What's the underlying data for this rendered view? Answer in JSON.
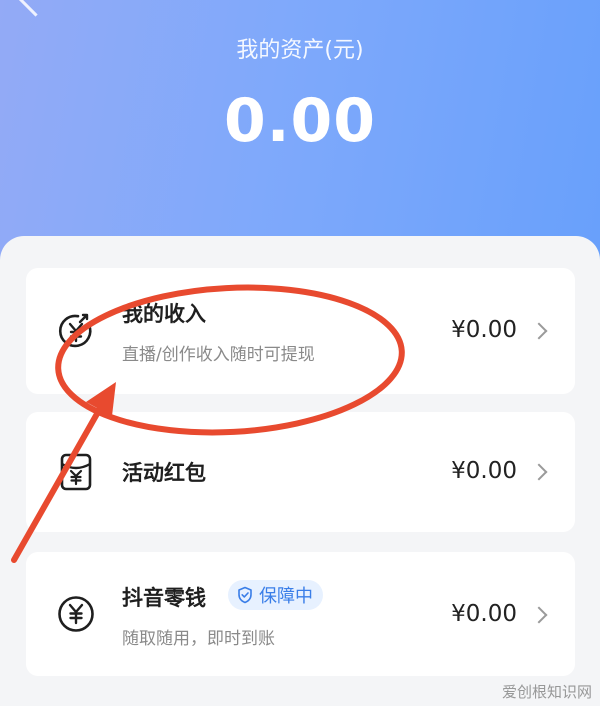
{
  "header": {
    "label": "我的资产(元)",
    "total": "0.00"
  },
  "items": [
    {
      "title": "我的收入",
      "subtitle": "直播/创作收入随时可提现",
      "amount": "¥0.00",
      "icon": "income-icon"
    },
    {
      "title": "活动红包",
      "subtitle": "",
      "amount": "¥0.00",
      "icon": "red-packet-icon"
    },
    {
      "title": "抖音零钱",
      "subtitle": "随取随用，即时到账",
      "amount": "¥0.00",
      "icon": "yuan-coin-icon",
      "badge": "保障中"
    }
  ],
  "watermark": "爱创根知识网",
  "colors": {
    "header_gradient_start": "#93aaf6",
    "header_gradient_end": "#68a0fb",
    "badge_bg": "#e7f1ff",
    "badge_text": "#3a7ee8",
    "annotation": "#e84a2f"
  }
}
